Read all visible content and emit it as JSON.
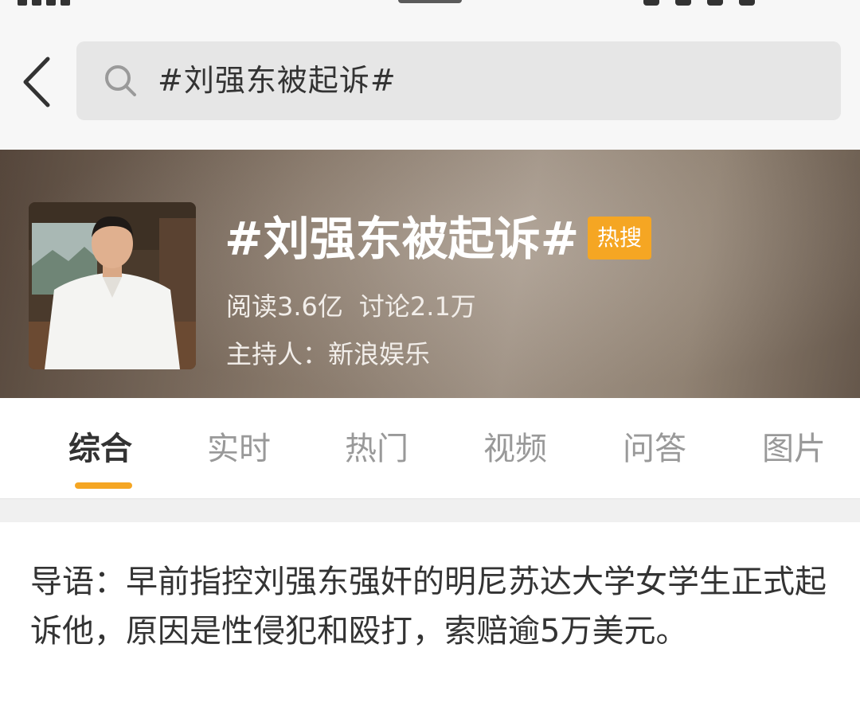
{
  "header": {
    "search_text": "#刘强东被起诉#"
  },
  "topic": {
    "title": "#刘强东被起诉#",
    "badge": "热搜",
    "reads": "阅读3.6亿",
    "discussions": "讨论2.1万",
    "host": "主持人：新浪娱乐"
  },
  "tabs": [
    {
      "label": "综合",
      "active": true
    },
    {
      "label": "实时",
      "active": false
    },
    {
      "label": "热门",
      "active": false
    },
    {
      "label": "视频",
      "active": false
    },
    {
      "label": "问答",
      "active": false
    },
    {
      "label": "图片",
      "active": false
    }
  ],
  "intro": {
    "text": "导语：早前指控刘强东强奸的明尼苏达大学女学生正式起诉他，原因是性侵犯和殴打，索赔逾5万美元。"
  },
  "colors": {
    "accent": "#f5a623",
    "search_bg": "#e6e6e6",
    "header_bg": "#f7f7f7"
  },
  "icons": {
    "back": "chevron-left-icon",
    "search": "search-icon"
  }
}
